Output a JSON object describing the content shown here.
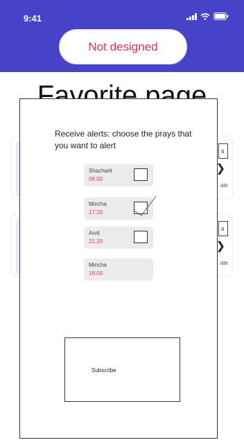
{
  "status_bar": {
    "time": "9:41"
  },
  "header": {
    "not_designed_label": "Not designed"
  },
  "page": {
    "title": "Favorite page"
  },
  "background_cards": [
    {
      "mini_box": "s",
      "rate_label": "ate"
    },
    {
      "mini_box": "s",
      "rate_label": "ate"
    }
  ],
  "modal": {
    "heading": "Receive alerts: choose the prays that you want to alert",
    "prays": [
      {
        "name": "Shacharit",
        "time": "08:00",
        "checked": false
      },
      {
        "name": "Mincha",
        "time": "17:20",
        "checked": true
      },
      {
        "name": "Arvit",
        "time": "21:20",
        "checked": false
      },
      {
        "name": "Mincha",
        "time": "18:00",
        "checked": false
      }
    ],
    "subscribe_label": "Subscribe"
  },
  "colors": {
    "header": "#4743c9",
    "accent_red": "#f22a5c",
    "time_red": "#ec3c4f"
  }
}
